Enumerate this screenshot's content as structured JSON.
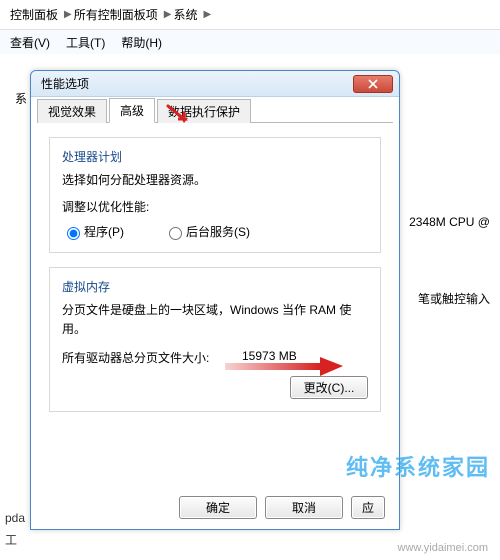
{
  "breadcrumb": {
    "items": [
      "控制面板",
      "所有控制面板项",
      "系统"
    ]
  },
  "menubar": {
    "view": "查看(V)",
    "tools": "工具(T)",
    "help": "帮助(H)"
  },
  "side_label_prefix": "系",
  "bg_right": {
    "cpu": "2348M CPU @",
    "pen": "笔或触控输入"
  },
  "dialog": {
    "title": "性能选项",
    "tabs": {
      "visual": "视觉效果",
      "advanced": "高级",
      "dep": "数据执行保护"
    },
    "processor": {
      "heading": "处理器计划",
      "desc": "选择如何分配处理器资源。",
      "adjust_label": "调整以优化性能:",
      "programs": "程序(P)",
      "background": "后台服务(S)"
    },
    "vm": {
      "heading": "虚拟内存",
      "desc": "分页文件是硬盘上的一块区域，Windows 当作 RAM 使用。",
      "total_label": "所有驱动器总分页文件大小:",
      "total_value": "15973 MB",
      "change_btn": "更改(C)..."
    },
    "buttons": {
      "ok": "确定",
      "cancel": "取消",
      "apply": "应"
    }
  },
  "bottom_left": {
    "line1": "pda",
    "line2": "工"
  },
  "watermark": {
    "main": "纯净系统家园",
    "url": "www.yidaimei.com"
  }
}
